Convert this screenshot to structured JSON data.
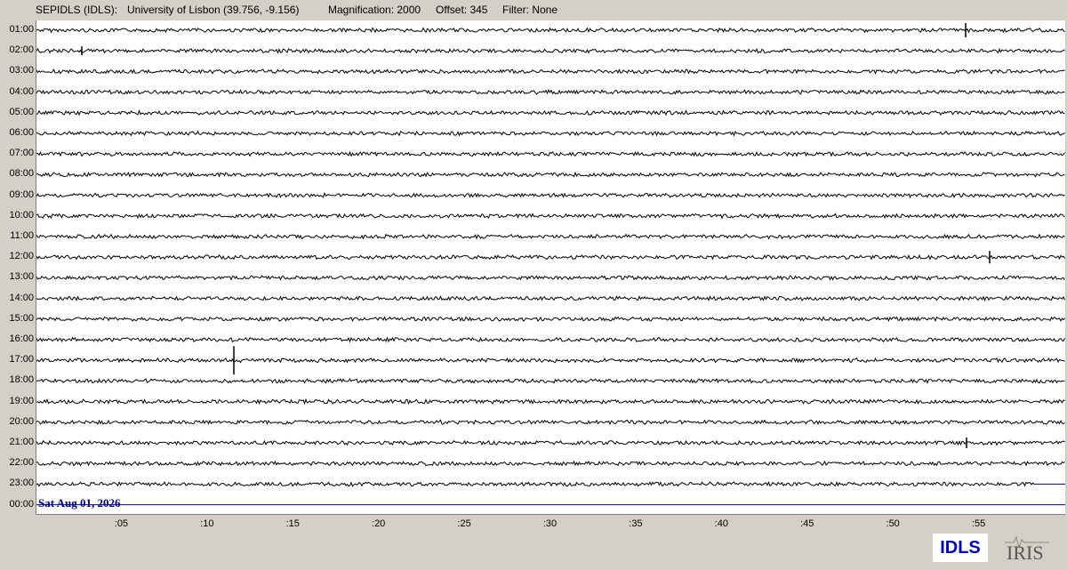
{
  "header": {
    "station": "SEPIDLS (IDLS):",
    "site": "University of Lisbon (39.756, -9.156)",
    "magnification": "Magnification: 2000",
    "offset": "Offset: 345",
    "filter": "Filter: None"
  },
  "hour_labels": [
    "01:00",
    "02:00",
    "03:00",
    "04:00",
    "05:00",
    "06:00",
    "07:00",
    "08:00",
    "09:00",
    "10:00",
    "11:00",
    "12:00",
    "13:00",
    "14:00",
    "15:00",
    "16:00",
    "17:00",
    "18:00",
    "19:00",
    "20:00",
    "21:00",
    "22:00",
    "23:00",
    "00:00"
  ],
  "minute_ticks": [
    ":05",
    ":10",
    ":15",
    ":20",
    ":25",
    ":30",
    ":35",
    ":40",
    ":45",
    ":50",
    ":55"
  ],
  "date_label": "Sat Aug 01, 2026",
  "logos": {
    "idls": "IDLS",
    "iris": "IRIS"
  },
  "colors": {
    "trace": "#000000",
    "current_line": "#00008b",
    "background": "#d4d0c8"
  }
}
